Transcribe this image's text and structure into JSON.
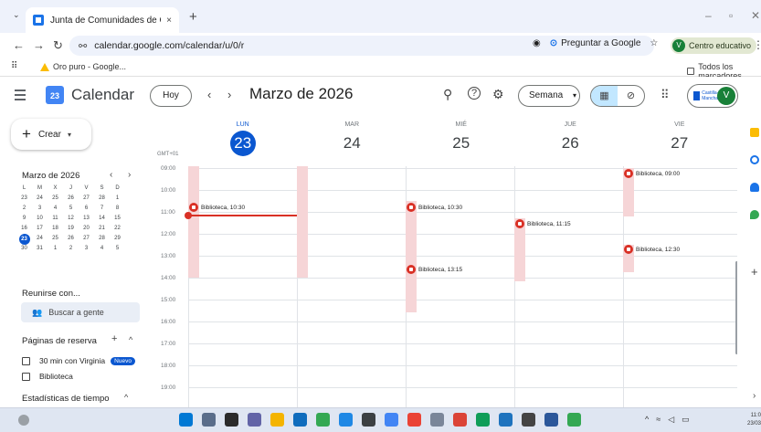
{
  "browser": {
    "tab_title": "Junta de Comunidades de Casti",
    "tab_close": "×",
    "new_tab": "+",
    "url": "calendar.google.com/calendar/u/0/r",
    "ask_google": "Preguntar a Google",
    "profile_initial": "V",
    "profile_label": "Centro educativo",
    "menu": "⋮",
    "bookmark_item": "Oro puro - Google...",
    "bookmarks_all": "Todos los marcadores"
  },
  "header": {
    "app_name": "Calendar",
    "logo_day": "23",
    "today_button": "Hoy",
    "prev": "‹",
    "next": "›",
    "month_title": "Marzo de 2026",
    "search_icon": "⚲",
    "help_icon": "?",
    "settings_icon": "⚙",
    "view_select": "Semana",
    "view_caret": "▾",
    "apps_icon": "⠿",
    "org_name": "Castilla-La Mancha",
    "account_initial": "V"
  },
  "sidebar": {
    "create_label": "Crear",
    "mini_month": "Marzo de 2026",
    "weekdays": [
      "L",
      "M",
      "X",
      "J",
      "V",
      "S",
      "D"
    ],
    "weeks": [
      [
        "23",
        "24",
        "25",
        "26",
        "27",
        "28",
        "1"
      ],
      [
        "2",
        "3",
        "4",
        "5",
        "6",
        "7",
        "8"
      ],
      [
        "9",
        "10",
        "11",
        "12",
        "13",
        "14",
        "15"
      ],
      [
        "16",
        "17",
        "18",
        "19",
        "20",
        "21",
        "22"
      ],
      [
        "23",
        "24",
        "25",
        "26",
        "27",
        "28",
        "29"
      ],
      [
        "30",
        "31",
        "1",
        "2",
        "3",
        "4",
        "5"
      ]
    ],
    "selected_day": "23",
    "meet_title": "Reunirse con...",
    "search_people": "Buscar a gente",
    "booking_title": "Páginas de reserva",
    "booking_items": [
      {
        "label": "30 min con Virginia",
        "badge": "Nuevo"
      },
      {
        "label": "Biblioteca",
        "badge": ""
      }
    ],
    "stats_title": "Estadísticas de tiempo"
  },
  "week": {
    "timezone": "GMT+01",
    "days": [
      {
        "name": "LUN",
        "num": "23",
        "today": true
      },
      {
        "name": "MAR",
        "num": "24",
        "today": false
      },
      {
        "name": "MIÉ",
        "num": "25",
        "today": false
      },
      {
        "name": "JUE",
        "num": "26",
        "today": false
      },
      {
        "name": "VIE",
        "num": "27",
        "today": false
      }
    ],
    "hours": [
      "09:00",
      "10:00",
      "11:00",
      "12:00",
      "13:00",
      "14:00",
      "15:00",
      "16:00",
      "17:00",
      "18:00",
      "19:00"
    ],
    "events": [
      {
        "day": 0,
        "time_label": "Biblioteca, 10:30"
      },
      {
        "day": 2,
        "time_label": "Biblioteca, 10:30"
      },
      {
        "day": 2,
        "time_label": "Biblioteca, 13:15"
      },
      {
        "day": 3,
        "time_label": "Biblioteca, 11:15"
      },
      {
        "day": 4,
        "time_label": "Biblioteca, 09:00"
      },
      {
        "day": 4,
        "time_label": "Biblioteca, 12:30"
      }
    ]
  },
  "colors": {
    "accent": "#0b57d0",
    "event_red": "#d93025",
    "event_bg": "#f6d5d7"
  }
}
